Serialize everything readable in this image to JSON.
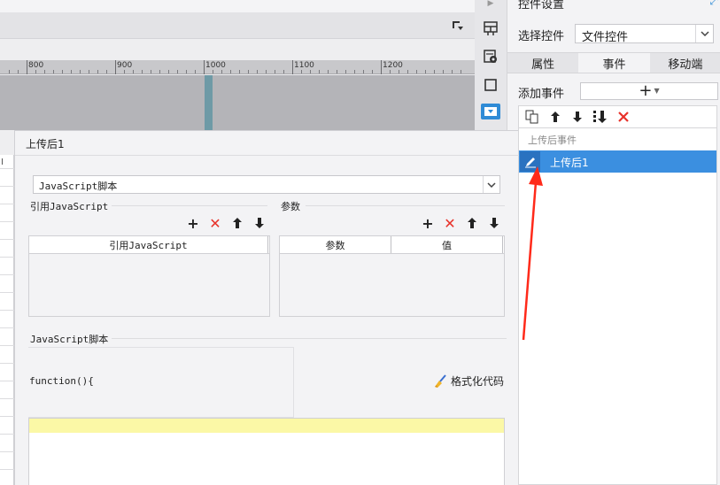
{
  "editor": {
    "ruler_labels": [
      "800",
      "900",
      "1000",
      "1100",
      "1200"
    ],
    "grid_char": "I"
  },
  "panel": {
    "title": "控件设置",
    "select_label": "选择控件",
    "select_value": "文件控件",
    "tabs": [
      {
        "label": "属性",
        "active": false
      },
      {
        "label": "事件",
        "active": true
      },
      {
        "label": "移动端",
        "active": false
      }
    ],
    "add_event_label": "添加事件",
    "add_event_symbol": "+",
    "event_group": "上传后事件",
    "event_item": "上传后1",
    "accent": "#3b8fe0"
  },
  "dialog": {
    "title": "上传后1",
    "script_type": "JavaScript脚本",
    "ref_js_label": "引用JavaScript",
    "ref_js_column": "引用JavaScript",
    "params_label": "参数",
    "params_columns": [
      "参数",
      "值"
    ],
    "script_section_label": "JavaScript脚本",
    "function_text": "function(){",
    "format_code_label": "格式化代码"
  },
  "icons": {
    "add": "plus-icon",
    "delete": "red-x-icon",
    "up": "arrow-up-icon",
    "down": "arrow-down-icon",
    "edit": "pencil-icon",
    "format": "broom-icon"
  },
  "symbols": {
    "plus": "+",
    "cross": "✕",
    "up": "🡑",
    "down": "🡓"
  }
}
